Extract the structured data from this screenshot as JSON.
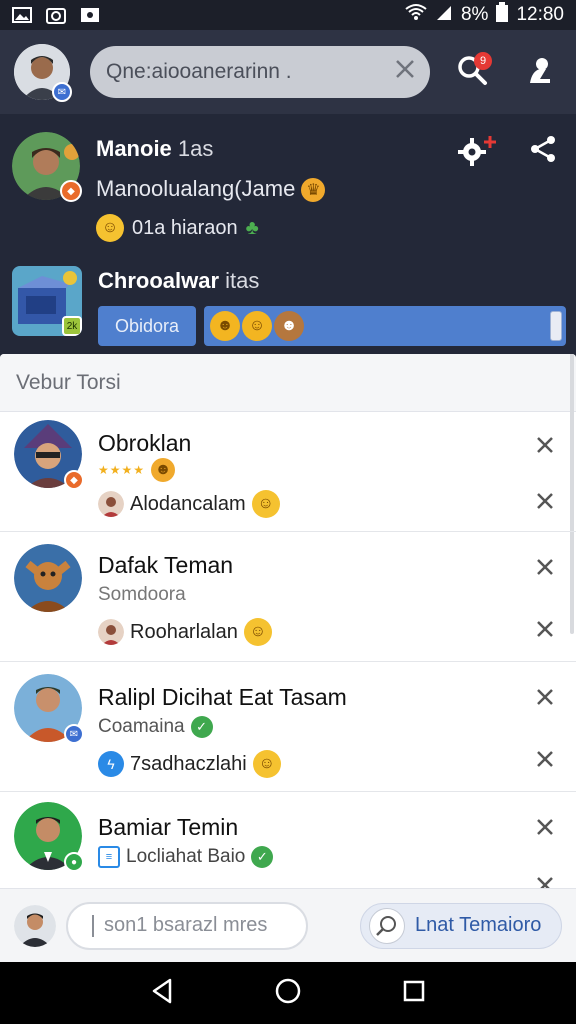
{
  "status_bar": {
    "battery": "8%",
    "time": "12:80"
  },
  "app_bar": {
    "search_text": "Qne:aiooanerarinn .",
    "notification_count": "9"
  },
  "post": {
    "title": "Manoie",
    "title_suffix": "1as",
    "subtitle": "Manoolualang⁠(Jame",
    "status_line": "01a hiaraon"
  },
  "game": {
    "title": "Chrooalwar",
    "title_suffix": "itas",
    "pill_label": "Obidora"
  },
  "sheet": {
    "header": "Vebur Torsi"
  },
  "friends": [
    {
      "name": "Obroklan",
      "meta": "",
      "mutual": "Alodancalam"
    },
    {
      "name": "Dafak Teman",
      "meta": "Somdoora",
      "mutual": "Rooharlalan"
    },
    {
      "name": "Ralipl Dicihat Eat Tasam",
      "meta": "Coamaina",
      "mutual": "7sadhaczlahi"
    },
    {
      "name": "Bamiar Temin",
      "meta": "Locliahat Baio",
      "mutual": ""
    }
  ],
  "composer": {
    "placeholder": "son1 bsarazl mres",
    "action_label": "Lnat Temaioro"
  },
  "colors": {
    "appbar": "#2e3344",
    "panel": "#232838",
    "accent_blue": "#4f7fce",
    "badge_red": "#e53935",
    "check_green": "#3fa84e"
  }
}
